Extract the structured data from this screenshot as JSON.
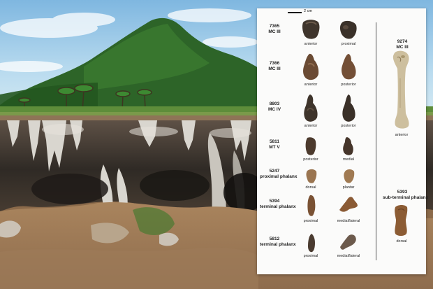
{
  "figure": {
    "scale": "2 cm",
    "specimens": [
      {
        "id": "7365",
        "desc": "MC III",
        "views": [
          "anterior",
          "proximal"
        ]
      },
      {
        "id": "7366",
        "desc": "MC III",
        "views": [
          "anterior",
          "posterior"
        ]
      },
      {
        "id": "8803",
        "desc": "MC IV",
        "views": [
          "anterior",
          "posterior"
        ]
      },
      {
        "id": "5811",
        "desc": "MT V",
        "views": [
          "posterior",
          "medial"
        ]
      },
      {
        "id": "5247",
        "desc": "proximal phalanx",
        "views": [
          "dorsal",
          "plantar"
        ]
      },
      {
        "id": "5394",
        "desc": "terminal phalanx",
        "views": [
          "proximal",
          "medial/lateral"
        ]
      },
      {
        "id": "5812",
        "desc": "terminal phalanx",
        "views": [
          "proximal",
          "medial/lateral"
        ]
      },
      {
        "id": "9274",
        "desc": "MC III",
        "views": [
          "anterior"
        ]
      },
      {
        "id": "5393",
        "desc": "sub-terminal phalanx",
        "views": [
          "dorsal"
        ]
      }
    ]
  },
  "colors": {
    "sky": "#8fc3e4",
    "foliage": "#2f6b2a",
    "soil": "#9a7654",
    "bone_dark": "#5a4536",
    "bone_light": "#cfc3ad"
  }
}
